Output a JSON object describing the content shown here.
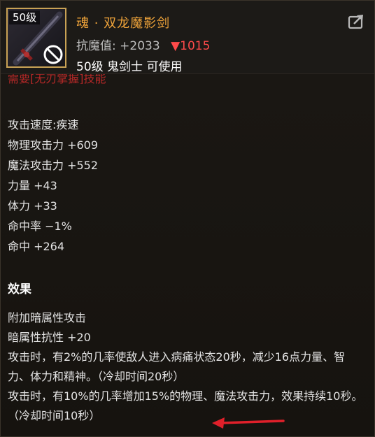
{
  "header": {
    "level_tag": "50级",
    "item_name": "魂 · 双龙魔影剑",
    "resist_label": "抗魔值:",
    "resist_value": "+2033",
    "resist_delta": "▼1015",
    "requirement": "50级 鬼剑士 可使用"
  },
  "cut_text": "需要[无刃掌握]技能",
  "stats": [
    "攻击速度:疾速",
    "物理攻击力 +609",
    "魔法攻击力 +552",
    "力量 +43",
    "体力 +33",
    "命中率 −1%",
    "命中 +264"
  ],
  "effects_title": "效果",
  "effects": [
    "附加暗属性攻击",
    "暗属性抗性 +20",
    "攻击时，有2%的几率使敌人进入病痛状态20秒，减少16点力量、智力、体力和精神。（冷却时间20秒）",
    "攻击时，有10%的几率增加15%的物理、魔法攻击力，效果持续10秒。（冷却时间10秒）"
  ],
  "colors": {
    "name": "#f0a43a",
    "decrease": "#ff4a4a",
    "frame": "#c9a255",
    "annotation_arrow": "#e0202a"
  },
  "icons": [
    "sword-icon",
    "no-use-icon",
    "share-icon",
    "annotation-arrow"
  ]
}
